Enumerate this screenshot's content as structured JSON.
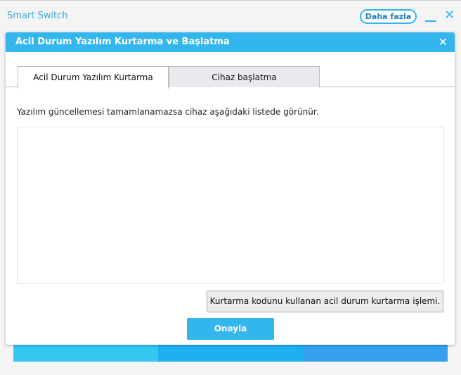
{
  "app": {
    "title": "Smart Switch",
    "more_label": "Daha fazla"
  },
  "dialog": {
    "title": "Acil Durum Yazılım Kurtarma ve Başlatma",
    "tabs": [
      {
        "label": "Acil Durum Yazılım Kurtarma",
        "active": true
      },
      {
        "label": "Cihaz başlatma",
        "active": false
      }
    ],
    "info": "Yazılım güncellemesi tamamlanamazsa cihaz aşağıdaki listede görünür.",
    "devices": [],
    "recovery_code_button": "Kurtarma kodunu kullanan acil durum kurtarma işlemi.",
    "confirm_button": "Onayla"
  },
  "colors": {
    "accent": "#33b6ee",
    "band1": "#35c7f2",
    "band2": "#1fb0f2",
    "band3": "#36a0f0"
  }
}
